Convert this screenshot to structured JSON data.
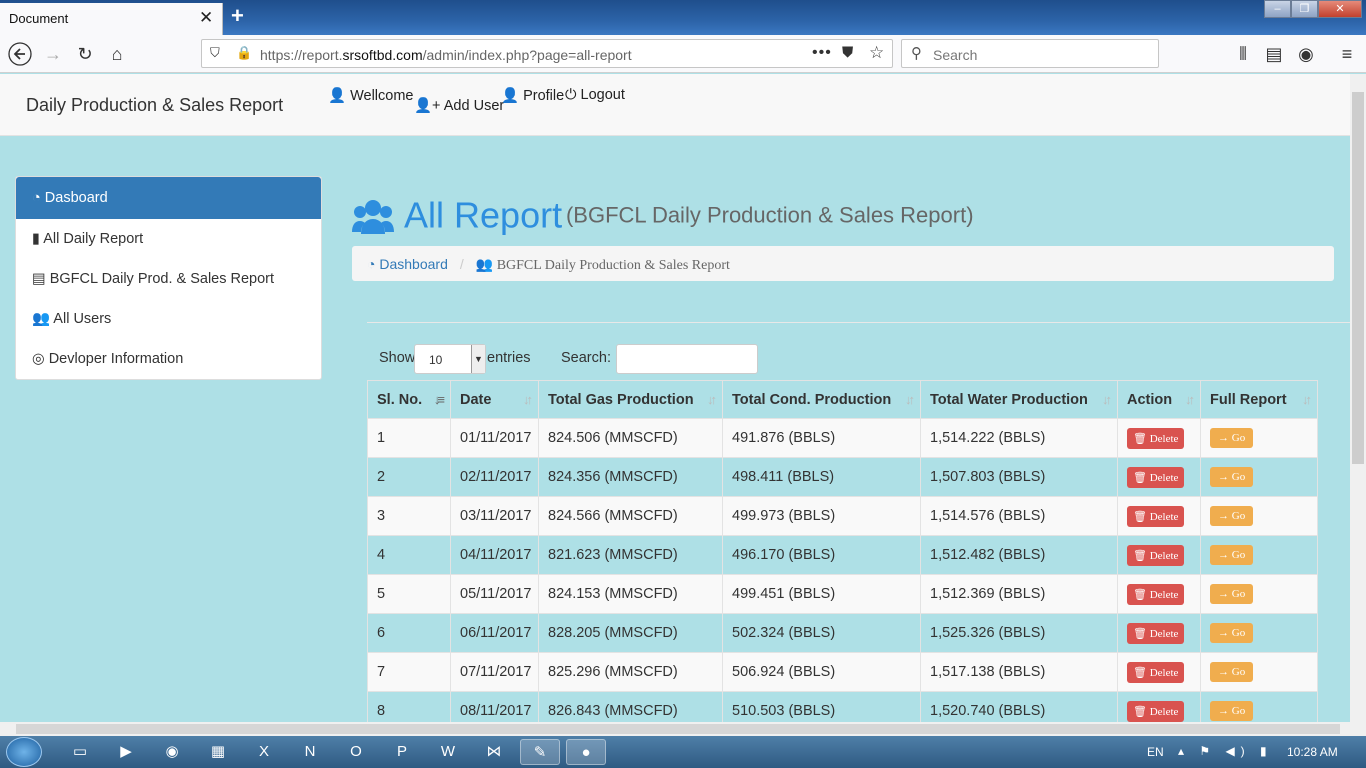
{
  "browser": {
    "tab_title": "Document",
    "tab_close": "✕",
    "new_tab": "+",
    "url_prefix": "https://report.",
    "url_domain": "srsoftbd.com",
    "url_path": "/admin/index.php?page=all-report",
    "search_placeholder": "Search",
    "win_buttons": [
      "–",
      "❐",
      "✕"
    ]
  },
  "topnav": {
    "brand": "Daily Production & Sales Report",
    "links": [
      {
        "icon": "user-icon",
        "label": "Wellcome"
      },
      {
        "icon": "user-plus-icon",
        "label": "Add User"
      },
      {
        "icon": "user-icon",
        "label": "Profile"
      },
      {
        "icon": "power-icon",
        "label": "Logout"
      }
    ]
  },
  "sidebar": {
    "items": [
      {
        "icon": "dashboard-icon",
        "label": "Dasboard"
      },
      {
        "icon": "file-icon",
        "label": "All Daily Report"
      },
      {
        "icon": "newspaper-icon",
        "label": "BGFCL Daily Prod. & Sales Report"
      },
      {
        "icon": "users-icon",
        "label": "All Users"
      },
      {
        "icon": "user-circle-icon",
        "label": "Devloper Information"
      }
    ]
  },
  "heading": {
    "title": "All Report",
    "subtitle": "(BGFCL Daily Production & Sales Report)"
  },
  "breadcrumb": {
    "home": "Dashboard",
    "separator": "/",
    "current": "BGFCL Daily Production & Sales Report"
  },
  "table_controls": {
    "show_label": "Show",
    "entries_value": "10",
    "entries_label": "entries",
    "search_label": "Search:",
    "search_value": ""
  },
  "table": {
    "headers": [
      "Sl. No.",
      "Date",
      "Total Gas Production",
      "Total Cond. Production",
      "Total Water Production",
      "Action",
      "Full Report"
    ],
    "delete_label": "Delete",
    "go_label": "Go",
    "rows": [
      {
        "sl": "1",
        "date": "01/11/2017",
        "gas": "824.506 (MMSCFD)",
        "cond": "491.876 (BBLS)",
        "water": "1,514.222 (BBLS)"
      },
      {
        "sl": "2",
        "date": "02/11/2017",
        "gas": "824.356 (MMSCFD)",
        "cond": "498.411 (BBLS)",
        "water": "1,507.803 (BBLS)"
      },
      {
        "sl": "3",
        "date": "03/11/2017",
        "gas": "824.566 (MMSCFD)",
        "cond": "499.973 (BBLS)",
        "water": "1,514.576 (BBLS)"
      },
      {
        "sl": "4",
        "date": "04/11/2017",
        "gas": "821.623 (MMSCFD)",
        "cond": "496.170 (BBLS)",
        "water": "1,512.482 (BBLS)"
      },
      {
        "sl": "5",
        "date": "05/11/2017",
        "gas": "824.153 (MMSCFD)",
        "cond": "499.451 (BBLS)",
        "water": "1,512.369 (BBLS)"
      },
      {
        "sl": "6",
        "date": "06/11/2017",
        "gas": "828.205 (MMSCFD)",
        "cond": "502.324 (BBLS)",
        "water": "1,525.326 (BBLS)"
      },
      {
        "sl": "7",
        "date": "07/11/2017",
        "gas": "825.296 (MMSCFD)",
        "cond": "506.924 (BBLS)",
        "water": "1,517.138 (BBLS)"
      },
      {
        "sl": "8",
        "date": "08/11/2017",
        "gas": "826.843 (MMSCFD)",
        "cond": "510.503 (BBLS)",
        "water": "1,520.740 (BBLS)"
      }
    ]
  },
  "taskbar": {
    "apps": [
      "explorer-icon",
      "media-player-icon",
      "chrome-icon",
      "calculator-icon",
      "excel-icon",
      "onenote-icon",
      "outlook-icon",
      "powerpoint-icon",
      "word-icon",
      "visual-studio-icon",
      "paint-icon",
      "firefox-icon"
    ],
    "lang": "EN",
    "time": "10:28 AM"
  },
  "colors": {
    "page_bg": "#aee0e6",
    "primary": "#337ab7",
    "heading": "#2e8ede",
    "danger": "#d9534f",
    "warning": "#f0ad4e"
  }
}
